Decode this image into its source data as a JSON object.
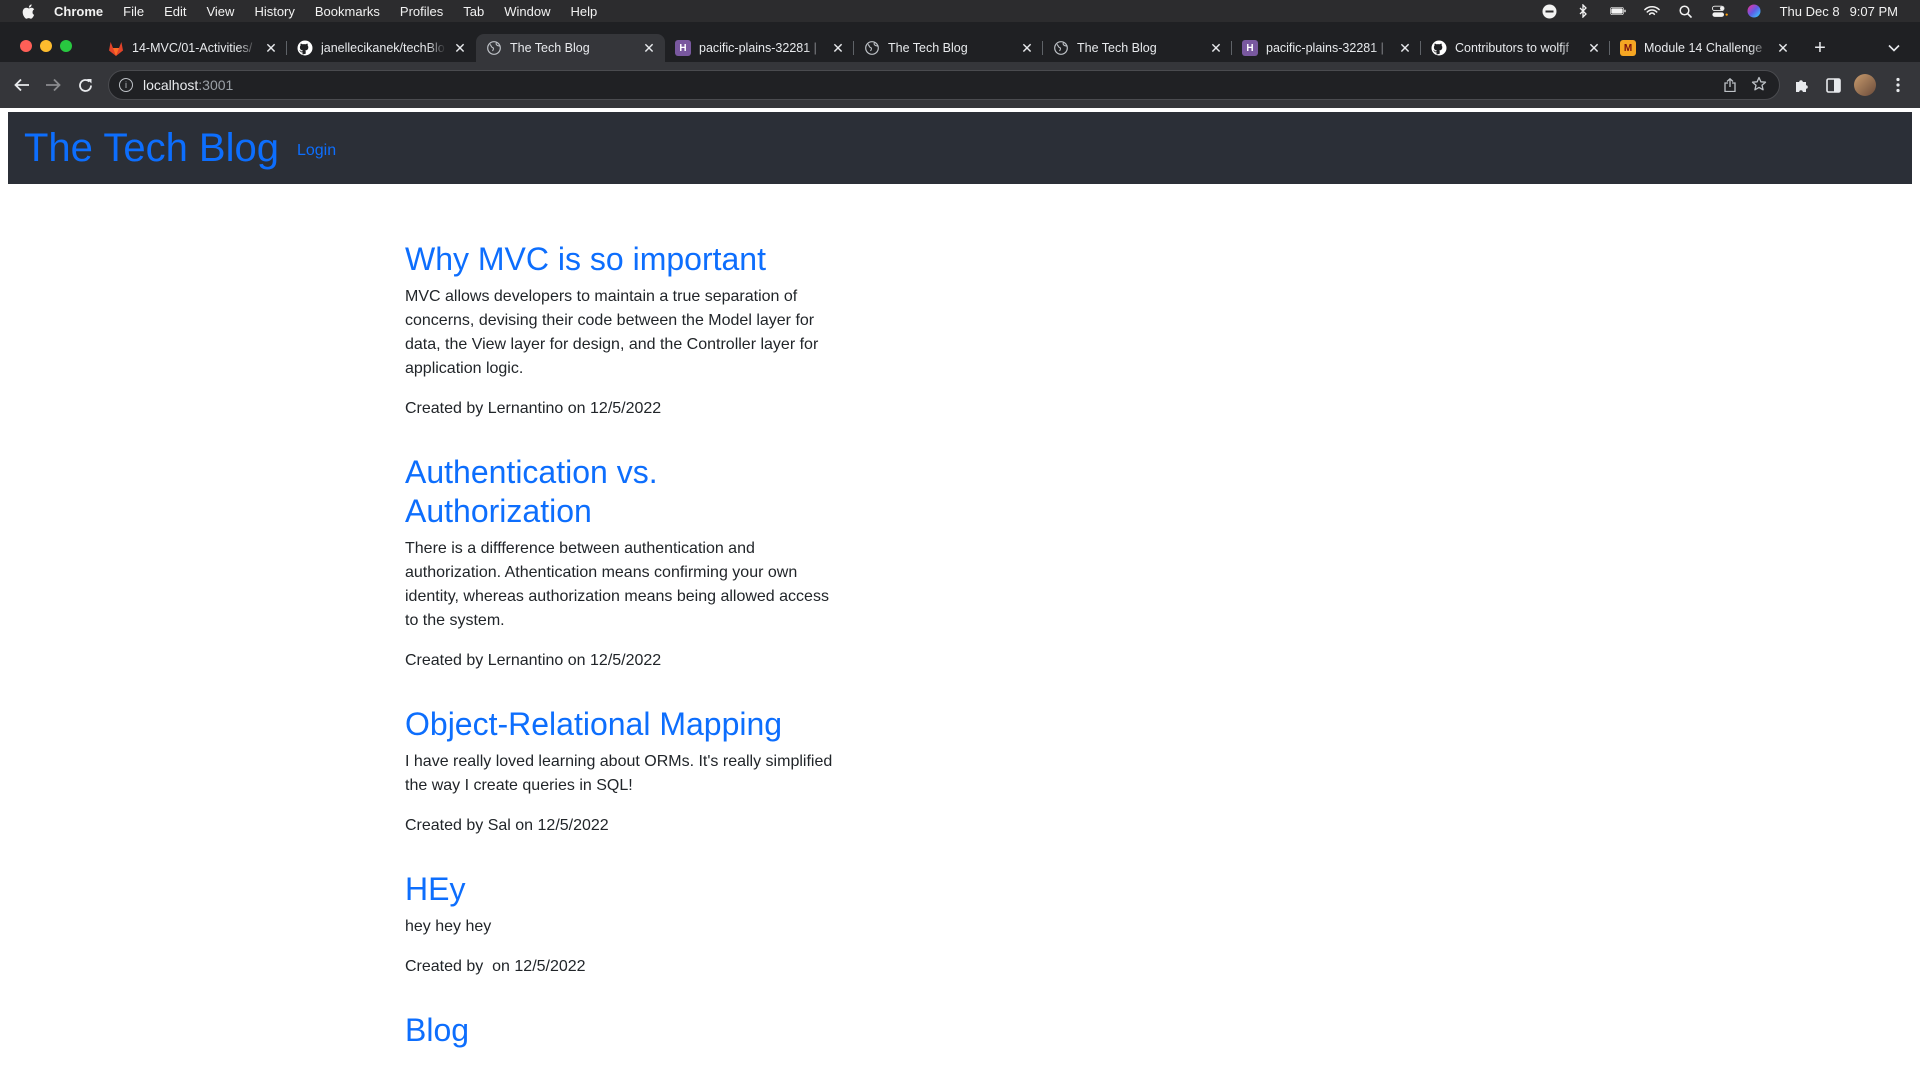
{
  "menubar": {
    "apple_icon": "apple-logo-icon",
    "app_name": "Chrome",
    "items": [
      "File",
      "Edit",
      "View",
      "History",
      "Bookmarks",
      "Profiles",
      "Tab",
      "Window",
      "Help"
    ],
    "status_icons": [
      "focus-icon",
      "bluetooth-icon",
      "battery-icon",
      "wifi-icon",
      "spotlight-icon",
      "control-center-icon",
      "siri-icon"
    ],
    "date": "Thu Dec 8",
    "time": "9:07 PM"
  },
  "tabs": [
    {
      "title": "14-MVC/01-Activities/",
      "favicon": "gitlab-icon",
      "color": "#e24329"
    },
    {
      "title": "janellecikanek/techBlo",
      "favicon": "github-icon",
      "color": "#ffffff"
    },
    {
      "title": "The Tech Blog",
      "favicon": "globe-icon",
      "color": "#bdc1c6",
      "active": true
    },
    {
      "title": "pacific-plains-32281 |",
      "favicon": "heroku-icon",
      "color": "#79589f"
    },
    {
      "title": "The Tech Blog",
      "favicon": "globe-icon",
      "color": "#bdc1c6"
    },
    {
      "title": "The Tech Blog",
      "favicon": "globe-icon",
      "color": "#bdc1c6"
    },
    {
      "title": "pacific-plains-32281 |",
      "favicon": "heroku-icon",
      "color": "#79589f"
    },
    {
      "title": "Contributors to wolfjf",
      "favicon": "github-icon",
      "color": "#ffffff"
    },
    {
      "title": "Module 14 Challenge",
      "favicon": "canvas-icon",
      "color": "#f5a623"
    }
  ],
  "omnibox": {
    "host": "localhost",
    "port": ":3001"
  },
  "site": {
    "brand": "The Tech Blog",
    "login": "Login",
    "accent": "#0d6efd",
    "header_bg": "#2b2f37"
  },
  "posts": [
    {
      "title": "Why MVC is so important",
      "body": "MVC allows developers to maintain a true separation of concerns, devising their code between the Model layer for data, the View layer for design, and the Controller layer for application logic.",
      "meta": "Created by Lernantino on 12/5/2022"
    },
    {
      "title": "Authentication vs. Authorization",
      "body": "There is a diffference between authentication and authorization. Athentication means confirming your own identity, whereas authorization means being allowed access to the system.",
      "meta": "Created by Lernantino on 12/5/2022"
    },
    {
      "title": "Object-Relational Mapping",
      "body": "I have really loved learning about ORMs. It's really simplified the way I create queries in SQL!",
      "meta": "Created by Sal on 12/5/2022"
    },
    {
      "title": "HEy",
      "body": "hey hey hey",
      "meta": "Created by  on 12/5/2022"
    },
    {
      "title": "Blog",
      "body": "",
      "meta": ""
    }
  ]
}
